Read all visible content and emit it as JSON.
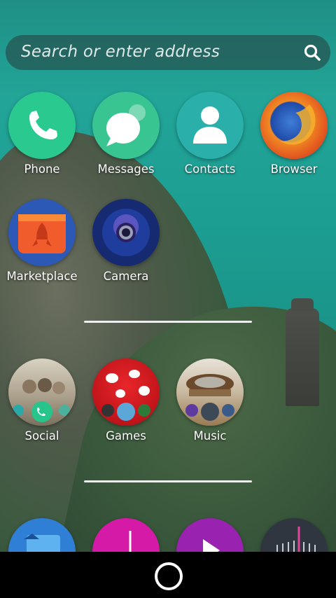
{
  "search": {
    "placeholder": "Search or enter address",
    "icon": "search-icon"
  },
  "apps": {
    "phone": {
      "label": "Phone",
      "color": "#27c48b"
    },
    "messages": {
      "label": "Messages",
      "color": "#35bf8e"
    },
    "contacts": {
      "label": "Contacts",
      "color": "#2aa9a8"
    },
    "browser": {
      "label": "Browser",
      "color": "#e8662a"
    },
    "marketplace": {
      "label": "Marketplace",
      "color": "#ef5a2a"
    },
    "camera": {
      "label": "Camera",
      "color": "#1d2f7a"
    }
  },
  "collections": {
    "social": {
      "label": "Social"
    },
    "games": {
      "label": "Games"
    },
    "music": {
      "label": "Music"
    }
  },
  "navbar": {
    "home_icon": "home-button-icon"
  }
}
